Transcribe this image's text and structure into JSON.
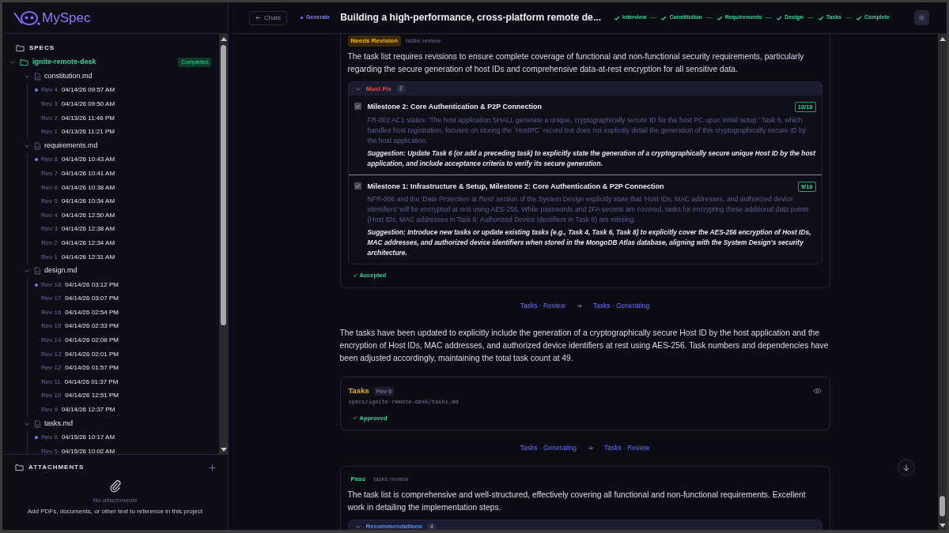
{
  "app": {
    "logo": "MySpec"
  },
  "sidebar": {
    "specs_title": "SPECS",
    "project": {
      "name": "ignite-remote-desk",
      "badge": "Completed",
      "expanded": true
    },
    "files": [
      {
        "name": "constitution.md",
        "expanded": true,
        "revisions": [
          {
            "rev": "Rev 4",
            "date": "04/14/26 09:57 AM",
            "current": true
          },
          {
            "rev": "Rev 3",
            "date": "04/14/26 09:50 AM",
            "current": false
          },
          {
            "rev": "Rev 2",
            "date": "04/13/26 11:46 PM",
            "current": false
          },
          {
            "rev": "Rev 1",
            "date": "04/13/26 11:21 PM",
            "current": false
          }
        ]
      },
      {
        "name": "requirements.md",
        "expanded": true,
        "revisions": [
          {
            "rev": "Rev 8",
            "date": "04/14/26 10:43 AM",
            "current": true
          },
          {
            "rev": "Rev 7",
            "date": "04/14/26 10:41 AM",
            "current": false
          },
          {
            "rev": "Rev 6",
            "date": "04/14/26 10:38 AM",
            "current": false
          },
          {
            "rev": "Rev 5",
            "date": "04/14/26 10:34 AM",
            "current": false
          },
          {
            "rev": "Rev 4",
            "date": "04/14/26 12:50 AM",
            "current": false
          },
          {
            "rev": "Rev 3",
            "date": "04/14/26 12:38 AM",
            "current": false
          },
          {
            "rev": "Rev 2",
            "date": "04/14/26 12:34 AM",
            "current": false
          },
          {
            "rev": "Rev 1",
            "date": "04/14/26 12:31 AM",
            "current": false
          }
        ]
      },
      {
        "name": "design.md",
        "expanded": true,
        "revisions": [
          {
            "rev": "Rev 18",
            "date": "04/14/26 03:12 PM",
            "current": true
          },
          {
            "rev": "Rev 17",
            "date": "04/14/26 03:07 PM",
            "current": false
          },
          {
            "rev": "Rev 16",
            "date": "04/14/26 02:54 PM",
            "current": false
          },
          {
            "rev": "Rev 15",
            "date": "04/14/26 02:33 PM",
            "current": false
          },
          {
            "rev": "Rev 14",
            "date": "04/14/26 02:08 PM",
            "current": false
          },
          {
            "rev": "Rev 13",
            "date": "04/14/26 02:01 PM",
            "current": false
          },
          {
            "rev": "Rev 12",
            "date": "04/14/26 01:57 PM",
            "current": false
          },
          {
            "rev": "Rev 11",
            "date": "04/14/26 01:37 PM",
            "current": false
          },
          {
            "rev": "Rev 10",
            "date": "04/14/26 12:51 PM",
            "current": false
          },
          {
            "rev": "Rev 9",
            "date": "04/14/26 12:37 PM",
            "current": false
          }
        ]
      },
      {
        "name": "tasks.md",
        "expanded": true,
        "revisions": [
          {
            "rev": "Rev 6",
            "date": "04/15/26 10:17 AM",
            "current": true
          },
          {
            "rev": "Rev 5",
            "date": "04/15/26 10:02 AM",
            "current": false
          }
        ]
      }
    ],
    "attachments": {
      "title": "ATTACHMENTS",
      "empty_title": "No attachments",
      "hint": "Add PDFs, documents, or other text to reference in this project"
    }
  },
  "header": {
    "back": "Chats",
    "mode": "Generate",
    "title": "Building a high-performance, cross-platform remote de...",
    "steps": [
      {
        "label": "Interview",
        "done": true
      },
      {
        "label": "Constitution",
        "done": true
      },
      {
        "label": "Requirements",
        "done": true
      },
      {
        "label": "Design",
        "done": true
      },
      {
        "label": "Tasks",
        "done": true
      },
      {
        "label": "Complete",
        "done": true
      }
    ]
  },
  "feed": [
    {
      "kind": "review",
      "status": "Needs Revision",
      "passed": false,
      "subtitle": "tasks review",
      "summary": "The task list requires revisions to ensure complete coverage of functional and non-functional security requirements, particularly regarding the secure generation of host IDs and comprehensive data-at-rest encryption for all sensitive data.",
      "group": {
        "title": "Must Fix",
        "color": "#f04a4a",
        "count": "2",
        "expanded": true,
        "items": [
          {
            "title": "Milestone 2: Core Authentication & P2P Connection",
            "score": "10/10",
            "checked": true,
            "detail": "FR-002 AC1 states: 'The host application SHALL generate a unique, cryptographically secure ID for the host PC upon initial setup.' Task 6, which handles host registration, focuses on storing the `HostPC` record but does not explicitly detail the generation of this cryptographically secure ID by the host application.",
            "suggestion": "Suggestion: Update Task 6 (or add a preceding task) to explicitly state the generation of a cryptographically secure unique Host ID by the host application, and include acceptance criteria to verify its secure generation."
          },
          {
            "title": "Milestone 1: Infrastructure & Setup, Milestone 2: Core Authentication & P2P Connection",
            "score": "9/10",
            "checked": true,
            "detail": "NFR-006 and the 'Data Protection at Rest' section of the System Design explicitly state that 'Host IDs, MAC addresses, and authorized device identifiers' will be encrypted at rest using AES-256. While passwords and 2FA secrets are covered, tasks for encrypting these additional data points (Host IDs, MAC addresses in Task 6; Authorized Device Identifiers in Task 8) are missing.",
            "suggestion": "Suggestion: Introduce new tasks or update existing tasks (e.g., Task 4, Task 6, Task 8) to explicitly cover the AES-256 encryption of Host IDs, MAC addresses, and authorized device identifiers when stored in the MongoDB Atlas database, aligning with the System Design's security architecture."
          }
        ]
      },
      "footer": "Accepted"
    },
    {
      "kind": "transition",
      "from": "Tasks · Review",
      "to": "Tasks · Generating"
    },
    {
      "kind": "message",
      "text": "The tasks have been updated to explicitly include the generation of a cryptographically secure Host ID by the host application and the encryption of Host IDs, MAC addresses, and authorized device identifiers at rest using AES-256. Task numbers and dependencies have been adjusted accordingly, maintaining the total task count at 49."
    },
    {
      "kind": "artifact",
      "title": "Tasks",
      "rev": "Rev 6",
      "path": "specs/ignite-remote-desk/tasks.md",
      "status": "Approved"
    },
    {
      "kind": "transition",
      "from": "Tasks · Generating",
      "to": "Tasks · Review"
    },
    {
      "kind": "review",
      "status": "Pass",
      "passed": true,
      "subtitle": "tasks review",
      "summary": "The task list is comprehensive and well-structured, effectively covering all functional and non-functional requirements. Excellent work in detailing the implementation steps.",
      "group": {
        "title": "Recommendations",
        "color": "#4c8ff5",
        "count": "4",
        "expanded": true
      }
    }
  ]
}
